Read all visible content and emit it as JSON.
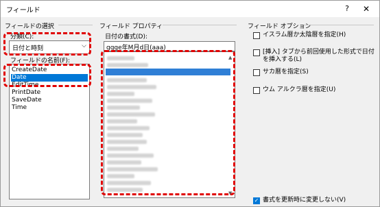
{
  "window": {
    "title": "フィールド",
    "help_glyph": "?",
    "close_glyph": "✕"
  },
  "left_panel": {
    "section_title": "フィールドの選択",
    "category_label": "分類(C):",
    "category_value": "日付と時刻",
    "fieldname_label": "フィールドの名前(F):",
    "fields": [
      "CreateDate",
      "Date",
      "EditTime",
      "PrintDate",
      "SaveDate",
      "Time"
    ],
    "selected_field": "Date"
  },
  "middle_panel": {
    "section_title": "フィールド プロパティ",
    "format_label": "日付の書式(D):",
    "format_value": "gggе年M月d日(aaa)"
  },
  "right_panel": {
    "section_title": "フィールド オプション",
    "options": [
      {
        "label": "イスラム暦か太陰暦を指定(H)",
        "checked": false
      },
      {
        "label": "[挿入] タブから前回使用した形式で日付を挿入する(L)",
        "checked": false
      },
      {
        "label": "サカ暦を指定(S)",
        "checked": false
      },
      {
        "label": "ウム アルクラ暦を指定(U)",
        "checked": false
      }
    ],
    "preserve_option": {
      "label": "書式を更新時に変更しない(V)",
      "checked": true
    }
  },
  "colors": {
    "accent": "#0078d7",
    "highlight_dashes": "#e00000"
  }
}
